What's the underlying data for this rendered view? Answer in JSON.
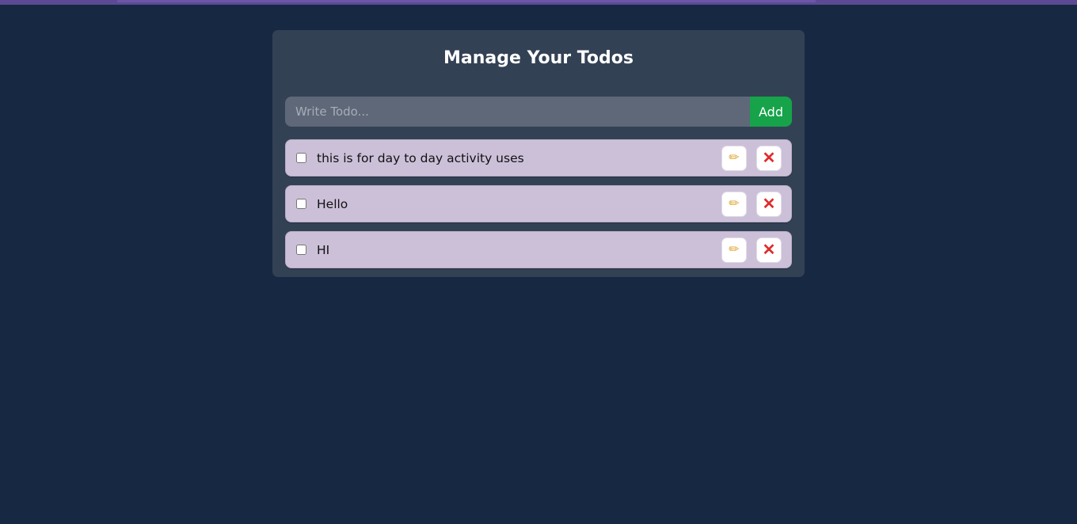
{
  "header": {
    "title": "Manage Your Todos"
  },
  "form": {
    "placeholder": "Write Todo...",
    "value": "",
    "add_label": "Add"
  },
  "todos": [
    {
      "text": "this is for day to day activity uses",
      "completed": false,
      "edit_icon": "pencil-icon",
      "delete_icon": "close-icon"
    },
    {
      "text": "Hello",
      "completed": false,
      "edit_icon": "pencil-icon",
      "delete_icon": "close-icon"
    },
    {
      "text": "HI",
      "completed": false,
      "edit_icon": "pencil-icon",
      "delete_icon": "close-icon"
    }
  ],
  "icons": {
    "edit_glyph": "✏",
    "delete_glyph": "✕"
  },
  "colors": {
    "background": "#172842",
    "card": "#334155",
    "input": "#5e6878",
    "add_button": "#16a34a",
    "todo_item": "#ccc0d9",
    "delete_icon": "#e02b2b",
    "edit_icon": "#e1a32f"
  }
}
